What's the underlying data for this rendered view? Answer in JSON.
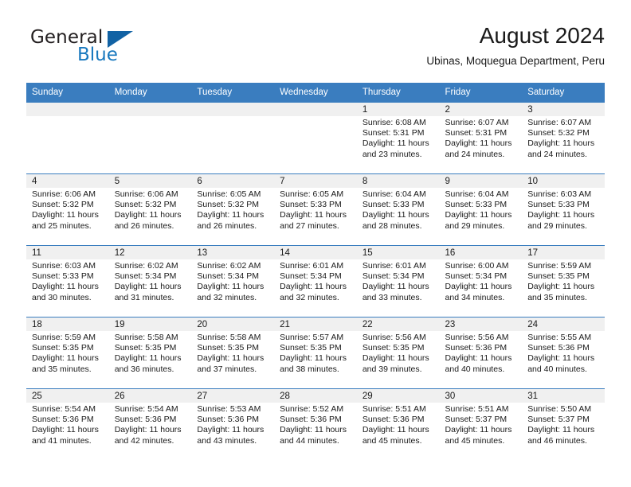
{
  "brand": {
    "name_dark": "General",
    "name_blue": "Blue",
    "accent_color": "#1878be",
    "triangle_color": "#1162a4"
  },
  "header": {
    "month_title": "August 2024",
    "location": "Ubinas, Moquegua Department, Peru"
  },
  "calendar": {
    "header_bg": "#3a7dbf",
    "daynum_bg": "#f0f0f0",
    "columns": [
      "Sunday",
      "Monday",
      "Tuesday",
      "Wednesday",
      "Thursday",
      "Friday",
      "Saturday"
    ],
    "weeks": [
      [
        {
          "day": "",
          "empty": true
        },
        {
          "day": "",
          "empty": true
        },
        {
          "day": "",
          "empty": true
        },
        {
          "day": "",
          "empty": true
        },
        {
          "day": "1",
          "sunrise": "Sunrise: 6:08 AM",
          "sunset": "Sunset: 5:31 PM",
          "daylight_1": "Daylight: 11 hours",
          "daylight_2": "and 23 minutes."
        },
        {
          "day": "2",
          "sunrise": "Sunrise: 6:07 AM",
          "sunset": "Sunset: 5:31 PM",
          "daylight_1": "Daylight: 11 hours",
          "daylight_2": "and 24 minutes."
        },
        {
          "day": "3",
          "sunrise": "Sunrise: 6:07 AM",
          "sunset": "Sunset: 5:32 PM",
          "daylight_1": "Daylight: 11 hours",
          "daylight_2": "and 24 minutes."
        }
      ],
      [
        {
          "day": "4",
          "sunrise": "Sunrise: 6:06 AM",
          "sunset": "Sunset: 5:32 PM",
          "daylight_1": "Daylight: 11 hours",
          "daylight_2": "and 25 minutes."
        },
        {
          "day": "5",
          "sunrise": "Sunrise: 6:06 AM",
          "sunset": "Sunset: 5:32 PM",
          "daylight_1": "Daylight: 11 hours",
          "daylight_2": "and 26 minutes."
        },
        {
          "day": "6",
          "sunrise": "Sunrise: 6:05 AM",
          "sunset": "Sunset: 5:32 PM",
          "daylight_1": "Daylight: 11 hours",
          "daylight_2": "and 26 minutes."
        },
        {
          "day": "7",
          "sunrise": "Sunrise: 6:05 AM",
          "sunset": "Sunset: 5:33 PM",
          "daylight_1": "Daylight: 11 hours",
          "daylight_2": "and 27 minutes."
        },
        {
          "day": "8",
          "sunrise": "Sunrise: 6:04 AM",
          "sunset": "Sunset: 5:33 PM",
          "daylight_1": "Daylight: 11 hours",
          "daylight_2": "and 28 minutes."
        },
        {
          "day": "9",
          "sunrise": "Sunrise: 6:04 AM",
          "sunset": "Sunset: 5:33 PM",
          "daylight_1": "Daylight: 11 hours",
          "daylight_2": "and 29 minutes."
        },
        {
          "day": "10",
          "sunrise": "Sunrise: 6:03 AM",
          "sunset": "Sunset: 5:33 PM",
          "daylight_1": "Daylight: 11 hours",
          "daylight_2": "and 29 minutes."
        }
      ],
      [
        {
          "day": "11",
          "sunrise": "Sunrise: 6:03 AM",
          "sunset": "Sunset: 5:33 PM",
          "daylight_1": "Daylight: 11 hours",
          "daylight_2": "and 30 minutes."
        },
        {
          "day": "12",
          "sunrise": "Sunrise: 6:02 AM",
          "sunset": "Sunset: 5:34 PM",
          "daylight_1": "Daylight: 11 hours",
          "daylight_2": "and 31 minutes."
        },
        {
          "day": "13",
          "sunrise": "Sunrise: 6:02 AM",
          "sunset": "Sunset: 5:34 PM",
          "daylight_1": "Daylight: 11 hours",
          "daylight_2": "and 32 minutes."
        },
        {
          "day": "14",
          "sunrise": "Sunrise: 6:01 AM",
          "sunset": "Sunset: 5:34 PM",
          "daylight_1": "Daylight: 11 hours",
          "daylight_2": "and 32 minutes."
        },
        {
          "day": "15",
          "sunrise": "Sunrise: 6:01 AM",
          "sunset": "Sunset: 5:34 PM",
          "daylight_1": "Daylight: 11 hours",
          "daylight_2": "and 33 minutes."
        },
        {
          "day": "16",
          "sunrise": "Sunrise: 6:00 AM",
          "sunset": "Sunset: 5:34 PM",
          "daylight_1": "Daylight: 11 hours",
          "daylight_2": "and 34 minutes."
        },
        {
          "day": "17",
          "sunrise": "Sunrise: 5:59 AM",
          "sunset": "Sunset: 5:35 PM",
          "daylight_1": "Daylight: 11 hours",
          "daylight_2": "and 35 minutes."
        }
      ],
      [
        {
          "day": "18",
          "sunrise": "Sunrise: 5:59 AM",
          "sunset": "Sunset: 5:35 PM",
          "daylight_1": "Daylight: 11 hours",
          "daylight_2": "and 35 minutes."
        },
        {
          "day": "19",
          "sunrise": "Sunrise: 5:58 AM",
          "sunset": "Sunset: 5:35 PM",
          "daylight_1": "Daylight: 11 hours",
          "daylight_2": "and 36 minutes."
        },
        {
          "day": "20",
          "sunrise": "Sunrise: 5:58 AM",
          "sunset": "Sunset: 5:35 PM",
          "daylight_1": "Daylight: 11 hours",
          "daylight_2": "and 37 minutes."
        },
        {
          "day": "21",
          "sunrise": "Sunrise: 5:57 AM",
          "sunset": "Sunset: 5:35 PM",
          "daylight_1": "Daylight: 11 hours",
          "daylight_2": "and 38 minutes."
        },
        {
          "day": "22",
          "sunrise": "Sunrise: 5:56 AM",
          "sunset": "Sunset: 5:35 PM",
          "daylight_1": "Daylight: 11 hours",
          "daylight_2": "and 39 minutes."
        },
        {
          "day": "23",
          "sunrise": "Sunrise: 5:56 AM",
          "sunset": "Sunset: 5:36 PM",
          "daylight_1": "Daylight: 11 hours",
          "daylight_2": "and 40 minutes."
        },
        {
          "day": "24",
          "sunrise": "Sunrise: 5:55 AM",
          "sunset": "Sunset: 5:36 PM",
          "daylight_1": "Daylight: 11 hours",
          "daylight_2": "and 40 minutes."
        }
      ],
      [
        {
          "day": "25",
          "sunrise": "Sunrise: 5:54 AM",
          "sunset": "Sunset: 5:36 PM",
          "daylight_1": "Daylight: 11 hours",
          "daylight_2": "and 41 minutes."
        },
        {
          "day": "26",
          "sunrise": "Sunrise: 5:54 AM",
          "sunset": "Sunset: 5:36 PM",
          "daylight_1": "Daylight: 11 hours",
          "daylight_2": "and 42 minutes."
        },
        {
          "day": "27",
          "sunrise": "Sunrise: 5:53 AM",
          "sunset": "Sunset: 5:36 PM",
          "daylight_1": "Daylight: 11 hours",
          "daylight_2": "and 43 minutes."
        },
        {
          "day": "28",
          "sunrise": "Sunrise: 5:52 AM",
          "sunset": "Sunset: 5:36 PM",
          "daylight_1": "Daylight: 11 hours",
          "daylight_2": "and 44 minutes."
        },
        {
          "day": "29",
          "sunrise": "Sunrise: 5:51 AM",
          "sunset": "Sunset: 5:36 PM",
          "daylight_1": "Daylight: 11 hours",
          "daylight_2": "and 45 minutes."
        },
        {
          "day": "30",
          "sunrise": "Sunrise: 5:51 AM",
          "sunset": "Sunset: 5:37 PM",
          "daylight_1": "Daylight: 11 hours",
          "daylight_2": "and 45 minutes."
        },
        {
          "day": "31",
          "sunrise": "Sunrise: 5:50 AM",
          "sunset": "Sunset: 5:37 PM",
          "daylight_1": "Daylight: 11 hours",
          "daylight_2": "and 46 minutes."
        }
      ]
    ]
  }
}
